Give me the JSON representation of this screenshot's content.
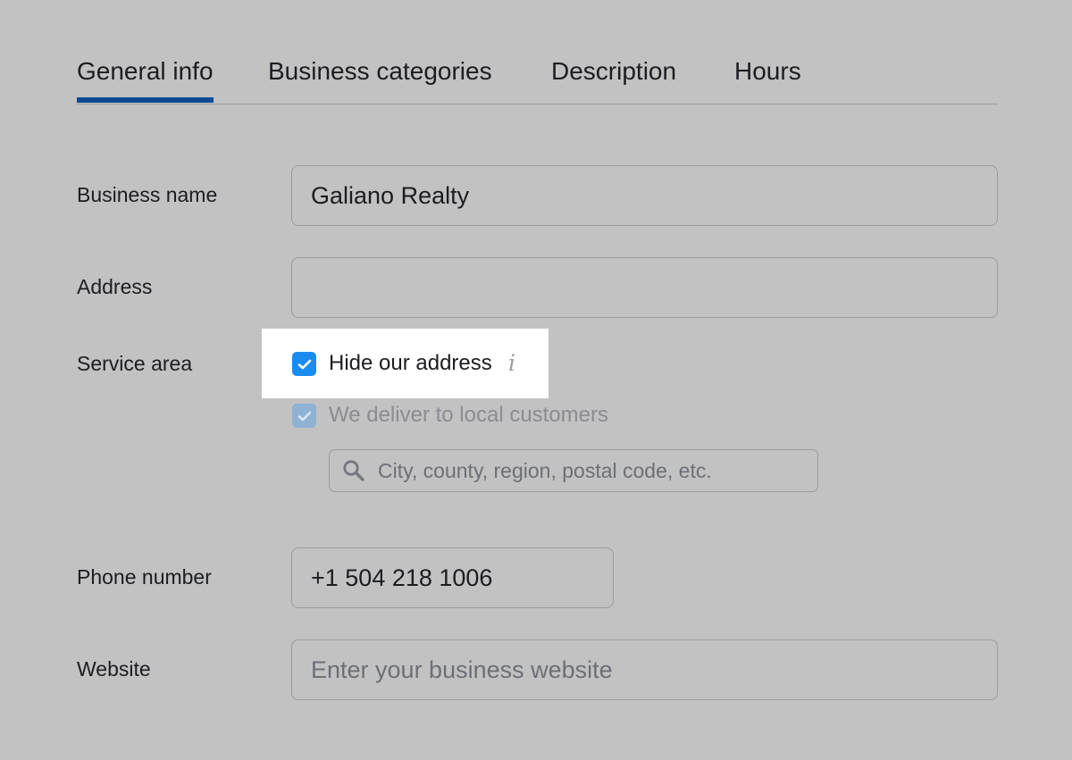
{
  "tabs": [
    {
      "label": "General info",
      "active": true
    },
    {
      "label": "Business categories",
      "active": false
    },
    {
      "label": "Description",
      "active": false
    },
    {
      "label": "Hours",
      "active": false
    }
  ],
  "form": {
    "business_name": {
      "label": "Business name",
      "value": "Galiano Realty"
    },
    "address": {
      "label": "Address",
      "value": ""
    },
    "service_area": {
      "label": "Service area",
      "hide_address": {
        "label": "Hide our address",
        "checked": true,
        "info_icon": "info-icon"
      },
      "deliver_local": {
        "label": "We deliver to local customers",
        "checked": true,
        "disabled": true
      },
      "search": {
        "placeholder": "City, county, region, postal code, etc.",
        "icon": "search-icon"
      }
    },
    "phone": {
      "label": "Phone number",
      "value": "+1 504 218 1006"
    },
    "website": {
      "label": "Website",
      "value": "",
      "placeholder": "Enter your business website"
    }
  },
  "colors": {
    "background": "#c2c2c2",
    "active_tab_underline": "#0a4b93",
    "checkbox_checked": "#1a8cf0",
    "checkbox_disabled": "#8fb2d3",
    "highlight": "#ffffff"
  }
}
